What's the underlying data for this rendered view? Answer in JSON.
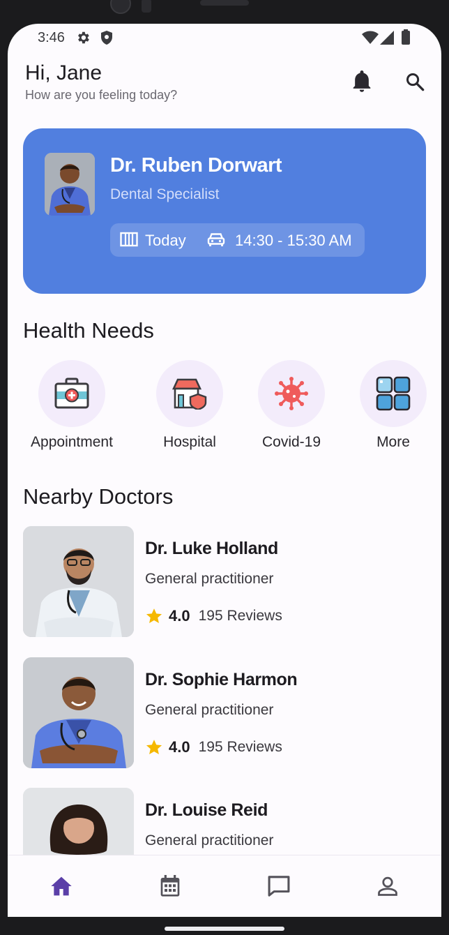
{
  "status_bar": {
    "time": "3:46"
  },
  "header": {
    "greeting": "Hi, Jane",
    "subtitle": "How are you feeling today?"
  },
  "appointment": {
    "doctor_name": "Dr. Ruben Dorwart",
    "specialty": "Dental Specialist",
    "date": "Today",
    "time": "14:30 - 15:30 AM",
    "color": "#517fdf"
  },
  "health_needs": {
    "title": "Health Needs",
    "items": [
      {
        "label": "Appointment",
        "icon": "medical-kit-icon"
      },
      {
        "label": "Hospital",
        "icon": "hospital-icon"
      },
      {
        "label": "Covid-19",
        "icon": "virus-icon"
      },
      {
        "label": "More",
        "icon": "grid-icon"
      }
    ]
  },
  "nearby": {
    "title": "Nearby Doctors",
    "doctors": [
      {
        "name": "Dr. Luke Holland",
        "specialty": "General practitioner",
        "rating": "4.0",
        "reviews": "195 Reviews"
      },
      {
        "name": "Dr. Sophie Harmon",
        "specialty": "General practitioner",
        "rating": "4.0",
        "reviews": "195 Reviews"
      },
      {
        "name": "Dr. Louise Reid",
        "specialty": "General practitioner",
        "rating": "",
        "reviews": ""
      }
    ]
  },
  "bottom_nav": {
    "items": [
      "home-icon",
      "calendar-icon",
      "chat-icon",
      "profile-icon"
    ],
    "active": "home-icon",
    "accent": "#5b3fa8"
  }
}
